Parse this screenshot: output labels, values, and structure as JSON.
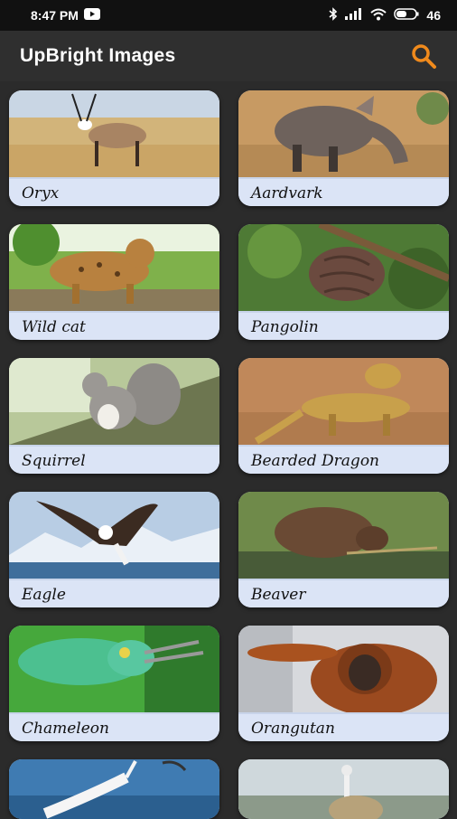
{
  "status_bar": {
    "time": "8:47 PM",
    "battery": "46"
  },
  "app": {
    "title": "UpBright Images",
    "search_icon": "search-icon",
    "accent": "#f08a1c"
  },
  "cards": [
    {
      "label": "Oryx"
    },
    {
      "label": "Aardvark"
    },
    {
      "label": "Wild cat"
    },
    {
      "label": "Pangolin"
    },
    {
      "label": "Squirrel"
    },
    {
      "label": "Bearded Dragon"
    },
    {
      "label": "Eagle"
    },
    {
      "label": "Beaver"
    },
    {
      "label": "Chameleon"
    },
    {
      "label": "Orangutan"
    }
  ]
}
